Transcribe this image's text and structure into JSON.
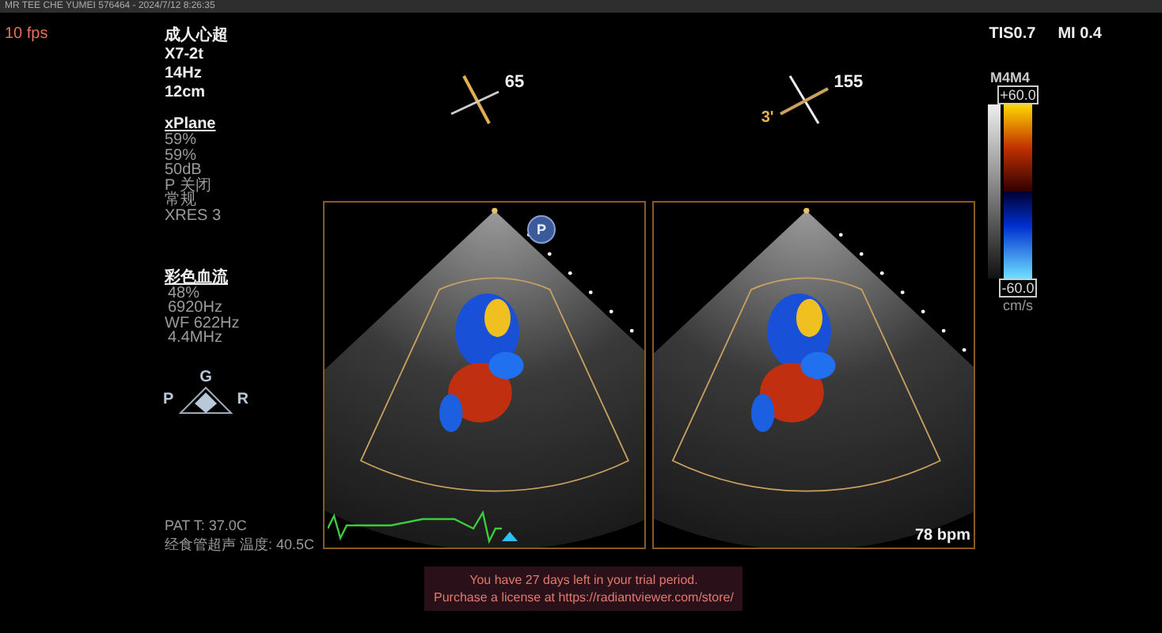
{
  "title_bar": "MR TEE CHE YUMEI 576464 - 2024/7/12 8:26:35",
  "frame_rate": "10 fps",
  "info": {
    "preset": "成人心超",
    "probe": "X7-2t",
    "frequency": "14Hz",
    "depth": "12cm"
  },
  "xplane": {
    "heading": "xPlane",
    "values": [
      "59%",
      "59%",
      "50dB",
      "P 关闭",
      "常规",
      "XRES 3"
    ]
  },
  "color_flow": {
    "heading": "彩色血流",
    "values": [
      "48%",
      "6920Hz",
      "WF 622Hz",
      "4.4MHz"
    ]
  },
  "orientation": {
    "top": "G",
    "left": "P",
    "right": "R"
  },
  "indices": [
    "TIS0.7",
    "MI 0.4"
  ],
  "planes": [
    {
      "angle": "65"
    },
    {
      "angle": "155",
      "mark": "3'"
    }
  ],
  "probe_badge": "P",
  "color_scale": {
    "map": "M4M4",
    "max": "+60.0",
    "min": "-60.0",
    "unit": "cm/s"
  },
  "temperatures": [
    "PAT T: 37.0C",
    "经食管超声 温度: 40.5C"
  ],
  "heart_rate": "78 bpm",
  "trial_notice": [
    "You have 27 days left in your trial period.",
    "Purchase a license at https://radiantviewer.com/store/"
  ]
}
